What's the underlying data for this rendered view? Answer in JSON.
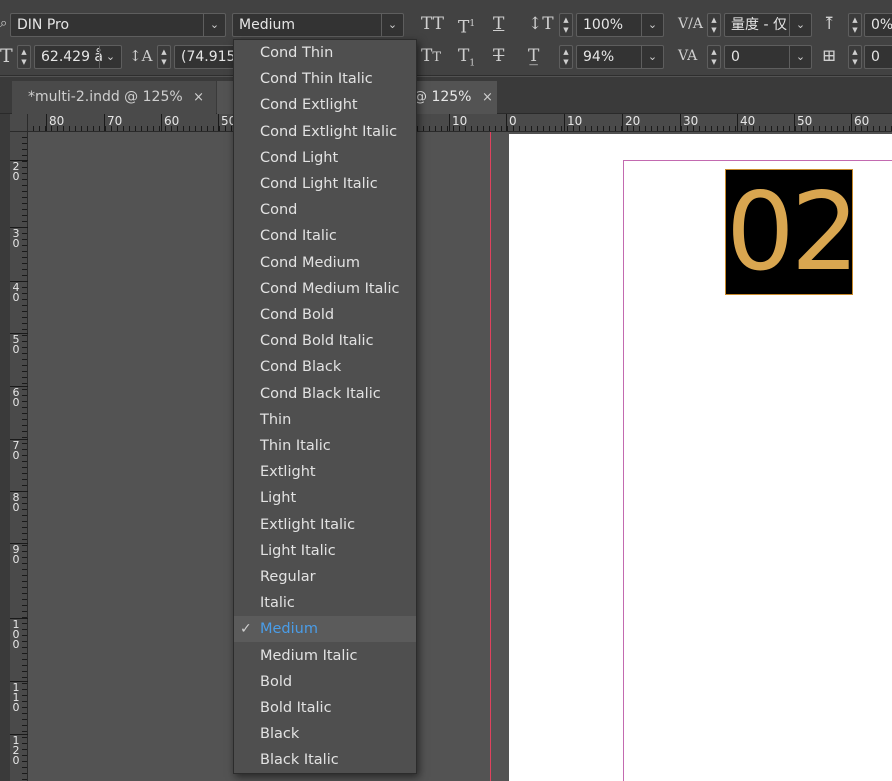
{
  "controlbar": {
    "font_family": "DIN Pro",
    "font_style": "Medium",
    "font_size": "62.429 å",
    "leading": "(74.915",
    "vertical_scale": "100%",
    "horizontal_scale": "94%",
    "kerning": "量度 - 仅",
    "tracking": "0",
    "baseline_shift": "0%",
    "skew": "0",
    "icons": [
      "tool-icon",
      "all-caps-icon",
      "superscript-icon",
      "underline-icon",
      "vertical-scale-icon",
      "small-caps-icon",
      "subscript-icon",
      "strikethrough-icon",
      "horizontal-scale-icon",
      "kerning-icon",
      "tracking-icon"
    ]
  },
  "tabs": [
    {
      "label": "*multi-2.indd @ 125%",
      "close": "×"
    },
    {
      "label": "@ 125%",
      "close": "×"
    }
  ],
  "ruler": {
    "h_labels": [
      "80",
      "70",
      "60",
      "50",
      "10",
      "0",
      "10",
      "20",
      "30",
      "40",
      "50",
      "60"
    ],
    "v_labels": [
      "2\n0",
      "3\n0",
      "4\n0",
      "5\n0",
      "6\n0",
      "7\n0",
      "8\n0",
      "9\n0",
      "1\n0\n0",
      "1\n1\n0",
      "1\n2\n0"
    ]
  },
  "document": {
    "number_text": "02"
  },
  "colors": {
    "accent_selected": "#4a9de8",
    "number_fill": "#d9a650",
    "number_frame_bg": "#000000",
    "bleed_guide": "#e0425e",
    "margin_guide": "#c36ab0"
  },
  "menu": {
    "selected": "Medium",
    "items": [
      "Cond Thin",
      "Cond Thin Italic",
      "Cond Extlight",
      "Cond Extlight Italic",
      "Cond Light",
      "Cond Light Italic",
      "Cond",
      "Cond Italic",
      "Cond Medium",
      "Cond Medium Italic",
      "Cond Bold",
      "Cond Bold Italic",
      "Cond Black",
      "Cond Black Italic",
      "Thin",
      "Thin Italic",
      "Extlight",
      "Light",
      "Extlight Italic",
      "Light Italic",
      "Regular",
      "Italic",
      "Medium",
      "Medium Italic",
      "Bold",
      "Bold Italic",
      "Black",
      "Black Italic"
    ]
  }
}
